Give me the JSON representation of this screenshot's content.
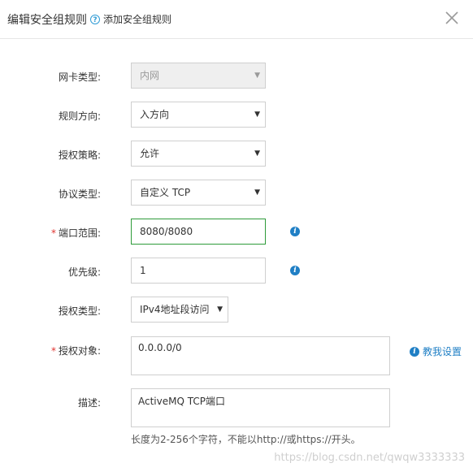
{
  "dialog": {
    "title": "编辑安全组规则",
    "help_link": "添加安全组规则",
    "close_icon": "close-icon"
  },
  "form": {
    "nic_type": {
      "label": "网卡类型:",
      "value": "内网",
      "disabled": true
    },
    "direction": {
      "label": "规则方向:",
      "value": "入方向"
    },
    "policy": {
      "label": "授权策略:",
      "value": "允许"
    },
    "protocol": {
      "label": "协议类型:",
      "value": "自定义 TCP"
    },
    "port_range": {
      "label": "端口范围:",
      "required": "*",
      "value": "8080/8080"
    },
    "priority": {
      "label": "优先级:",
      "value": "1"
    },
    "auth_type": {
      "label": "授权类型:",
      "value": "IPv4地址段访问"
    },
    "auth_object": {
      "label": "授权对象:",
      "required": "*",
      "value": "0.0.0.0/0",
      "help_link": "教我设置"
    },
    "description": {
      "label": "描述:",
      "value": "ActiveMQ TCP端口",
      "hint": "长度为2-256个字符，不能以http://或https://开头。"
    }
  },
  "watermark": "https://blog.csdn.net/qwqw3333333",
  "colors": {
    "accent": "#1f7fc5",
    "focus_border": "#2e9b3a",
    "required": "#e0332f"
  }
}
